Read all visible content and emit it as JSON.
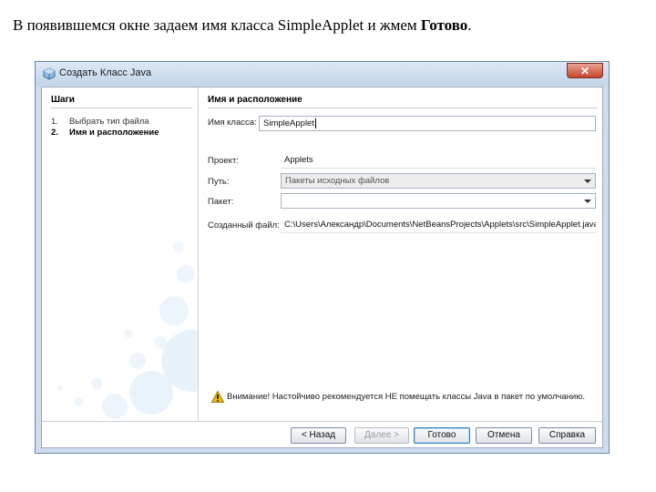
{
  "caption": {
    "prefix": "В появившемся окне задаем имя класса SimpleApplet и жмем ",
    "bold": "Готово",
    "suffix": "."
  },
  "window": {
    "title": "Создать Класс Java",
    "close_glyph": "✕"
  },
  "steps": {
    "title": "Шаги",
    "items": [
      {
        "num": "1.",
        "label": "Выбрать тип файла"
      },
      {
        "num": "2.",
        "label": "Имя и расположение"
      }
    ]
  },
  "form": {
    "title": "Имя и расположение",
    "class_name_label": "Имя класса:",
    "class_name_value": "SimpleApplet",
    "project_label": "Проект:",
    "project_value": "Applets",
    "location_label": "Путь:",
    "location_value": "Пакеты исходных файлов",
    "package_label": "Пакет:",
    "package_value": "",
    "created_file_label": "Созданный файл:",
    "created_file_value": "C:\\Users\\Александр\\Documents\\NetBeansProjects\\Applets\\src\\SimpleApplet.java"
  },
  "warning": {
    "icon": "warning-icon",
    "text": "Внимание! Настойчиво рекомендуется НЕ помещать классы Java в пакет по умолчанию."
  },
  "buttons": {
    "back": "< Назад",
    "next": "Далее >",
    "finish": "Готово",
    "cancel": "Отмена",
    "help": "Справка"
  },
  "colors": {
    "window_frame": "#cfdced",
    "close_button": "#c6452c",
    "default_button_border": "#3c7fb1",
    "warning_yellow": "#f2c200"
  }
}
